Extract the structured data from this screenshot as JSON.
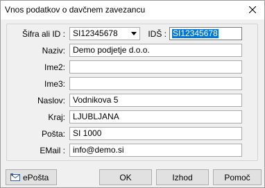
{
  "window": {
    "title": "Vnos podatkov o davčnem zavezancu"
  },
  "form": {
    "sifra_label": "Šifra ali ID :",
    "sifra_value": "SI12345678",
    "ids_label": "IDŠ :",
    "ids_value": "SI12345678",
    "naziv_label": "Naziv:",
    "naziv_value": "Demo podjetje d.o.o.",
    "ime2_label": "Ime2:",
    "ime2_value": "",
    "ime3_label": "Ime3:",
    "ime3_value": "",
    "naslov_label": "Naslov:",
    "naslov_value": "Vodnikova 5",
    "kraj_label": "Kraj:",
    "kraj_value": "LJUBLJANA",
    "posta_label": "Pošta:",
    "posta_value": "SI 1000",
    "email_label": "EMail :",
    "email_value": "info@demo.si"
  },
  "buttons": {
    "eposta": "ePošta",
    "ok": "OK",
    "izhod": "Izhod",
    "pomoc": "Pomoč"
  },
  "icons": {
    "close": "close-icon",
    "dropdown": "chevron-down-icon",
    "mail": "mail-icon"
  }
}
